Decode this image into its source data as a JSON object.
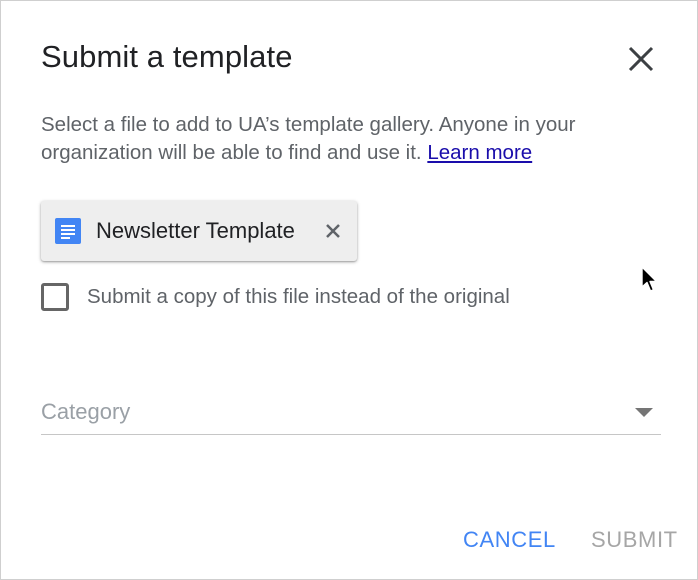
{
  "dialog": {
    "title": "Submit a template",
    "description": "Select a file to add to UA’s template gallery. Anyone in your organization will be able to find and use it.",
    "learn_more": "Learn more",
    "file_chip": {
      "label": "Newsletter Template",
      "icon": "google-docs-icon",
      "icon_color": "#4285f4"
    },
    "checkbox": {
      "label": "Submit a copy of this file instead of the original",
      "checked": false
    },
    "category": {
      "placeholder": "Category"
    },
    "buttons": {
      "cancel": "CANCEL",
      "submit": "SUBMIT"
    },
    "colors": {
      "accent": "#4285f4",
      "disabled": "#a6a6a6",
      "link": "#1a0dab"
    }
  }
}
